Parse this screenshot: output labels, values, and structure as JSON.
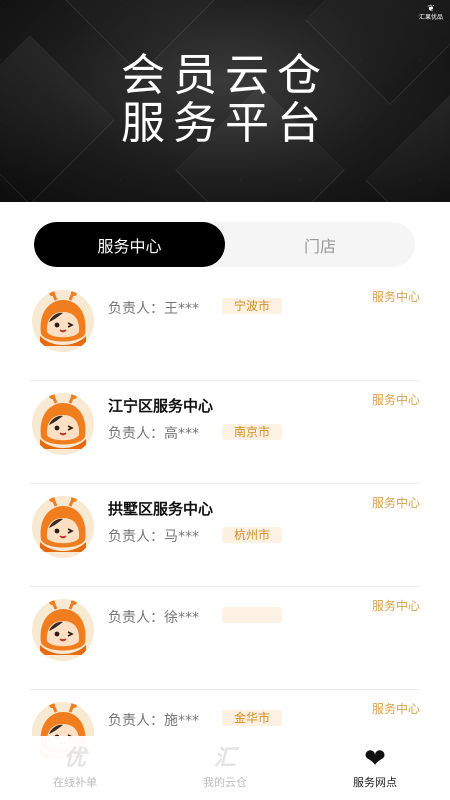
{
  "header": {
    "title_line1": "会员云仓",
    "title_line2": "服务平台",
    "logo_text": "汇果优品"
  },
  "tabs": [
    {
      "label": "服务中心",
      "active": true
    },
    {
      "label": "门店",
      "active": false
    }
  ],
  "items": [
    {
      "name": "",
      "owner_label": "负责人：",
      "owner": "王***",
      "city": "宁波市",
      "type": "服务中心"
    },
    {
      "name": "江宁区服务中心",
      "owner_label": "负责人：",
      "owner": "高***",
      "city": "南京市",
      "type": "服务中心"
    },
    {
      "name": "拱墅区服务中心",
      "owner_label": "负责人：",
      "owner": "马***",
      "city": "杭州市",
      "type": "服务中心"
    },
    {
      "name": "",
      "owner_label": "负责人：",
      "owner": "徐***",
      "city": "",
      "type": "服务中心"
    },
    {
      "name": "",
      "owner_label": "负责人：",
      "owner": "施***",
      "city": "金华市",
      "type": "服务中心"
    }
  ],
  "bottom_nav": [
    {
      "icon": "优",
      "icon_name": "youxuan-icon",
      "label": "在线补单",
      "active": false
    },
    {
      "icon": "汇",
      "icon_name": "huiyun-icon",
      "label": "我的云仓",
      "active": false
    },
    {
      "icon": "❤",
      "icon_name": "heart-icon",
      "label": "服务网点",
      "active": true
    }
  ],
  "colors": {
    "accent": "#d8a24a",
    "badge_bg": "#fdf1e4",
    "badge_text": "#d28d1f",
    "tab_active_bg": "#000000"
  }
}
